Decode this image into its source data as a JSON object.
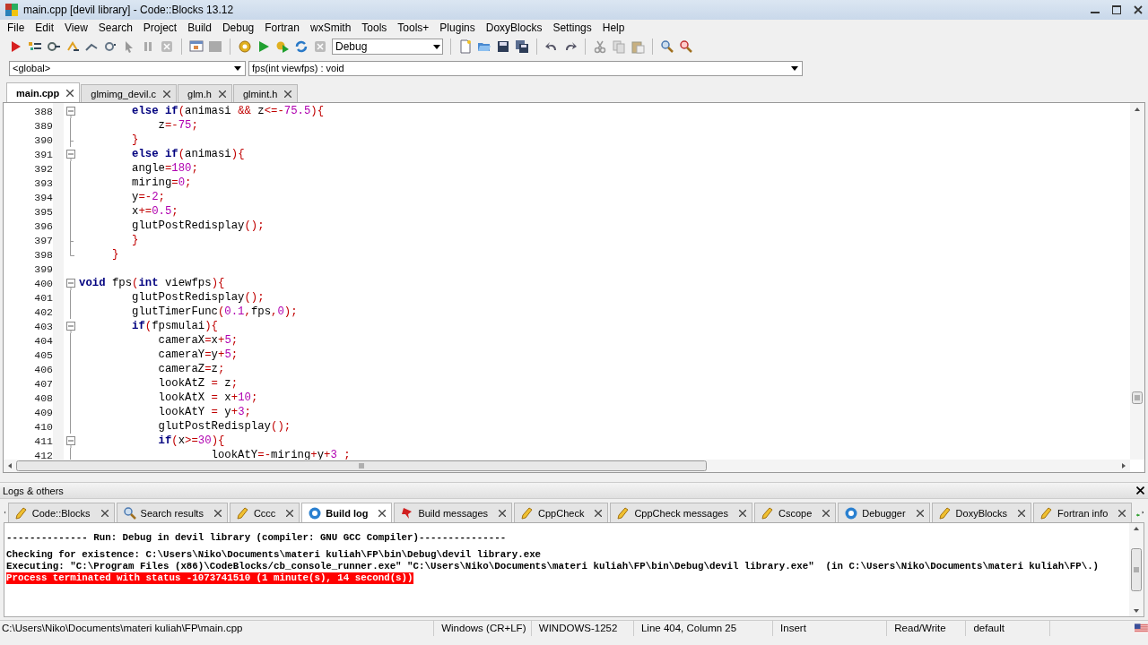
{
  "window": {
    "title": "main.cpp [devil library] - Code::Blocks 13.12"
  },
  "menu": [
    "File",
    "Edit",
    "View",
    "Search",
    "Project",
    "Build",
    "Debug",
    "Fortran",
    "wxSmith",
    "Tools",
    "Tools+",
    "Plugins",
    "DoxyBlocks",
    "Settings",
    "Help"
  ],
  "toolbar": {
    "build_target": "Debug"
  },
  "scope": {
    "left": "<global>",
    "right": "fps(int viewfps) : void"
  },
  "editor_tabs": [
    {
      "label": "main.cpp",
      "selected": true
    },
    {
      "label": "glmimg_devil.c",
      "selected": false
    },
    {
      "label": "glm.h",
      "selected": false
    },
    {
      "label": "glmint.h",
      "selected": false
    }
  ],
  "editor": {
    "lines": [
      {
        "number": "388",
        "kind": "open",
        "tokens": [
          {
            "kind": "kw",
            "text": "        else if"
          },
          {
            "kind": "op",
            "text": "("
          },
          {
            "kind": "id",
            "text": "animasi "
          },
          {
            "kind": "op",
            "text": "&&"
          },
          {
            "kind": "id",
            "text": " z"
          },
          {
            "kind": "op",
            "text": "<=-"
          },
          {
            "kind": "num",
            "text": "75.5"
          },
          {
            "kind": "op",
            "text": "){"
          }
        ]
      },
      {
        "number": "389",
        "kind": "line",
        "tokens": [
          {
            "kind": "id",
            "text": "            z"
          },
          {
            "kind": "op",
            "text": "=-"
          },
          {
            "kind": "num",
            "text": "75"
          },
          {
            "kind": "op",
            "text": ";"
          }
        ]
      },
      {
        "number": "390",
        "kind": "close",
        "tokens": [
          {
            "kind": "op",
            "text": "        }"
          }
        ]
      },
      {
        "number": "391",
        "kind": "open",
        "tokens": [
          {
            "kind": "kw",
            "text": "        else if"
          },
          {
            "kind": "op",
            "text": "("
          },
          {
            "kind": "id",
            "text": "animasi"
          },
          {
            "kind": "op",
            "text": "){"
          }
        ]
      },
      {
        "number": "392",
        "kind": "line",
        "tokens": [
          {
            "kind": "id",
            "text": "        angle"
          },
          {
            "kind": "op",
            "text": "="
          },
          {
            "kind": "num",
            "text": "180"
          },
          {
            "kind": "op",
            "text": ";"
          }
        ]
      },
      {
        "number": "393",
        "kind": "line",
        "tokens": [
          {
            "kind": "id",
            "text": "        miring"
          },
          {
            "kind": "op",
            "text": "="
          },
          {
            "kind": "num",
            "text": "0"
          },
          {
            "kind": "op",
            "text": ";"
          }
        ]
      },
      {
        "number": "394",
        "kind": "line",
        "tokens": [
          {
            "kind": "id",
            "text": "        y"
          },
          {
            "kind": "op",
            "text": "=-"
          },
          {
            "kind": "num",
            "text": "2"
          },
          {
            "kind": "op",
            "text": ";"
          }
        ]
      },
      {
        "number": "395",
        "kind": "line",
        "tokens": [
          {
            "kind": "id",
            "text": "        x"
          },
          {
            "kind": "op",
            "text": "+="
          },
          {
            "kind": "num",
            "text": "0.5"
          },
          {
            "kind": "op",
            "text": ";"
          }
        ]
      },
      {
        "number": "396",
        "kind": "line",
        "tokens": [
          {
            "kind": "id",
            "text": "        glutPostRedisplay"
          },
          {
            "kind": "op",
            "text": "();"
          }
        ]
      },
      {
        "number": "397",
        "kind": "close",
        "tokens": [
          {
            "kind": "op",
            "text": "        }"
          }
        ]
      },
      {
        "number": "398",
        "kind": "last",
        "tokens": [
          {
            "kind": "op",
            "text": "     }"
          }
        ]
      },
      {
        "number": "399",
        "kind": "plain"
      },
      {
        "number": "400",
        "kind": "open",
        "tokens": [
          {
            "kind": "kw",
            "text": "void"
          },
          {
            "kind": "id",
            "text": " fps"
          },
          {
            "kind": "op",
            "text": "("
          },
          {
            "kind": "kw",
            "text": "int"
          },
          {
            "kind": "id",
            "text": " viewfps"
          },
          {
            "kind": "op",
            "text": "){"
          }
        ]
      },
      {
        "number": "401",
        "kind": "line",
        "tokens": [
          {
            "kind": "id",
            "text": "        glutPostRedisplay"
          },
          {
            "kind": "op",
            "text": "();"
          }
        ]
      },
      {
        "number": "402",
        "kind": "line",
        "tokens": [
          {
            "kind": "id",
            "text": "        glutTimerFunc"
          },
          {
            "kind": "op",
            "text": "("
          },
          {
            "kind": "num",
            "text": "0.1"
          },
          {
            "kind": "op",
            "text": ","
          },
          {
            "kind": "id",
            "text": "fps"
          },
          {
            "kind": "op",
            "text": ","
          },
          {
            "kind": "num",
            "text": "0"
          },
          {
            "kind": "op",
            "text": ");"
          }
        ]
      },
      {
        "number": "403",
        "kind": "open",
        "tokens": [
          {
            "kind": "kw",
            "text": "        if"
          },
          {
            "kind": "op",
            "text": "("
          },
          {
            "kind": "id",
            "text": "fpsmulai"
          },
          {
            "kind": "op",
            "text": "){"
          }
        ]
      },
      {
        "number": "404",
        "kind": "line",
        "tokens": [
          {
            "kind": "id",
            "text": "            cameraX"
          },
          {
            "kind": "op",
            "text": "="
          },
          {
            "kind": "id",
            "text": "x"
          },
          {
            "kind": "op",
            "text": "+"
          },
          {
            "kind": "num",
            "text": "5"
          },
          {
            "kind": "op",
            "text": ";"
          }
        ]
      },
      {
        "number": "405",
        "kind": "line",
        "tokens": [
          {
            "kind": "id",
            "text": "            cameraY"
          },
          {
            "kind": "op",
            "text": "="
          },
          {
            "kind": "id",
            "text": "y"
          },
          {
            "kind": "op",
            "text": "+"
          },
          {
            "kind": "num",
            "text": "5"
          },
          {
            "kind": "op",
            "text": ";"
          }
        ]
      },
      {
        "number": "406",
        "kind": "line",
        "tokens": [
          {
            "kind": "id",
            "text": "            cameraZ"
          },
          {
            "kind": "op",
            "text": "="
          },
          {
            "kind": "id",
            "text": "z"
          },
          {
            "kind": "op",
            "text": ";"
          }
        ]
      },
      {
        "number": "407",
        "kind": "line",
        "tokens": [
          {
            "kind": "id",
            "text": "            lookAtZ "
          },
          {
            "kind": "op",
            "text": "="
          },
          {
            "kind": "id",
            "text": " z"
          },
          {
            "kind": "op",
            "text": ";"
          }
        ]
      },
      {
        "number": "408",
        "kind": "line",
        "tokens": [
          {
            "kind": "id",
            "text": "            lookAtX "
          },
          {
            "kind": "op",
            "text": "="
          },
          {
            "kind": "id",
            "text": " x"
          },
          {
            "kind": "op",
            "text": "+"
          },
          {
            "kind": "num",
            "text": "10"
          },
          {
            "kind": "op",
            "text": ";"
          }
        ]
      },
      {
        "number": "409",
        "kind": "line",
        "tokens": [
          {
            "kind": "id",
            "text": "            lookAtY "
          },
          {
            "kind": "op",
            "text": "="
          },
          {
            "kind": "id",
            "text": " y"
          },
          {
            "kind": "op",
            "text": "+"
          },
          {
            "kind": "num",
            "text": "3"
          },
          {
            "kind": "op",
            "text": ";"
          }
        ]
      },
      {
        "number": "410",
        "kind": "line",
        "tokens": [
          {
            "kind": "id",
            "text": "            glutPostRedisplay"
          },
          {
            "kind": "op",
            "text": "();"
          }
        ]
      },
      {
        "number": "411",
        "kind": "open",
        "tokens": [
          {
            "kind": "kw",
            "text": "            if"
          },
          {
            "kind": "op",
            "text": "("
          },
          {
            "kind": "id",
            "text": "x"
          },
          {
            "kind": "op",
            "text": ">="
          },
          {
            "kind": "num",
            "text": "30"
          },
          {
            "kind": "op",
            "text": "){"
          }
        ]
      },
      {
        "number": "412",
        "kind": "line",
        "tokens": [
          {
            "kind": "id",
            "text": "                    lookAtY"
          },
          {
            "kind": "op",
            "text": "=-"
          },
          {
            "kind": "id",
            "text": "miring"
          },
          {
            "kind": "op",
            "text": "+"
          },
          {
            "kind": "id",
            "text": "y"
          },
          {
            "kind": "op",
            "text": "+"
          },
          {
            "kind": "num",
            "text": "3"
          },
          {
            "kind": "op",
            "text": " ;"
          }
        ]
      }
    ]
  },
  "logs": {
    "title": "Logs & others",
    "tabs": [
      {
        "label": "Code::Blocks",
        "selected": false
      },
      {
        "label": "Search results",
        "selected": false
      },
      {
        "label": "Cccc",
        "selected": false
      },
      {
        "label": "Build log",
        "selected": true
      },
      {
        "label": "Build messages",
        "selected": false
      },
      {
        "label": "CppCheck",
        "selected": false
      },
      {
        "label": "CppCheck messages",
        "selected": false
      },
      {
        "label": "Cscope",
        "selected": false
      },
      {
        "label": "Debugger",
        "selected": false
      },
      {
        "label": "DoxyBlocks",
        "selected": false
      },
      {
        "label": "Fortran info",
        "selected": false
      }
    ],
    "lines": [
      {
        "kind": "header",
        "text": "-------------- Run: Debug in devil library (compiler: GNU GCC Compiler)---------------"
      },
      {
        "kind": "plain",
        "text": "Checking for existence: C:\\Users\\Niko\\Documents\\materi kuliah\\FP\\bin\\Debug\\devil library.exe"
      },
      {
        "kind": "plain",
        "text": "Executing: \"C:\\Program Files (x86)\\CodeBlocks/cb_console_runner.exe\" \"C:\\Users\\Niko\\Documents\\materi kuliah\\FP\\bin\\Debug\\devil library.exe\"  (in C:\\Users\\Niko\\Documents\\materi kuliah\\FP\\.)"
      },
      {
        "kind": "error",
        "text": "Process terminated with status -1073741510 (1 minute(s), 14 second(s))"
      }
    ]
  },
  "status_bar": [
    "C:\\Users\\Niko\\Documents\\materi kuliah\\FP\\main.cpp",
    "Windows (CR+LF)",
    "WINDOWS-1252",
    "Line 404, Column 25",
    "Insert",
    "Read/Write",
    "default"
  ]
}
